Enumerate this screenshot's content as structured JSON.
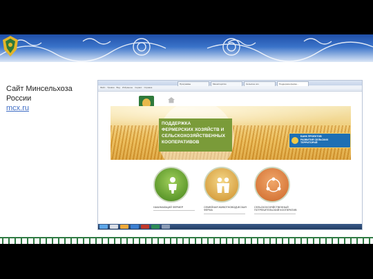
{
  "caption": {
    "title_line1": "Сайт Минсельхоза",
    "title_line2": "России",
    "link": "mcx.ru"
  },
  "browser": {
    "tabs": [
      "Программы",
      "Министерство",
      "Сельское хоз.",
      "Поддержка ферме..."
    ],
    "menu": [
      "Файл",
      "Правка",
      "Вид",
      "Избранное",
      "Сервис",
      "Справка"
    ]
  },
  "banner": {
    "lines": [
      "ПОДДЕРЖКА",
      "ФЕРМЕРСКИХ ХОЗЯЙСТВ И",
      "СЕЛЬСКОХОЗЯЙСТВЕННЫХ",
      "КООПЕРАТИВОВ"
    ],
    "bank_link": [
      "БАНК ПРОЕКТОВ",
      "РАЗВИТИЯ СЕЛЬСКИХ",
      "ТЕРРИТОРИЙ"
    ]
  },
  "cards": [
    {
      "label": "НАЧИНАЮЩИЙ ФЕРМЕР",
      "icon": "person-icon"
    },
    {
      "label": "СЕМЕЙНАЯ ЖИВОТНОВОДЧЕСКАЯ ФЕРМА",
      "icon": "family-icon"
    },
    {
      "label": "СЕЛЬСКОХОЗЯЙСТВЕННЫЙ ПОТРЕБИТЕЛЬСКИЙ КООПЕРАТИВ",
      "icon": "cooperative-icon"
    }
  ],
  "colors": {
    "ornament_blue": "#1f4fa8",
    "banner_green": "#7a9b39",
    "link_blue": "#3c6bc4"
  }
}
